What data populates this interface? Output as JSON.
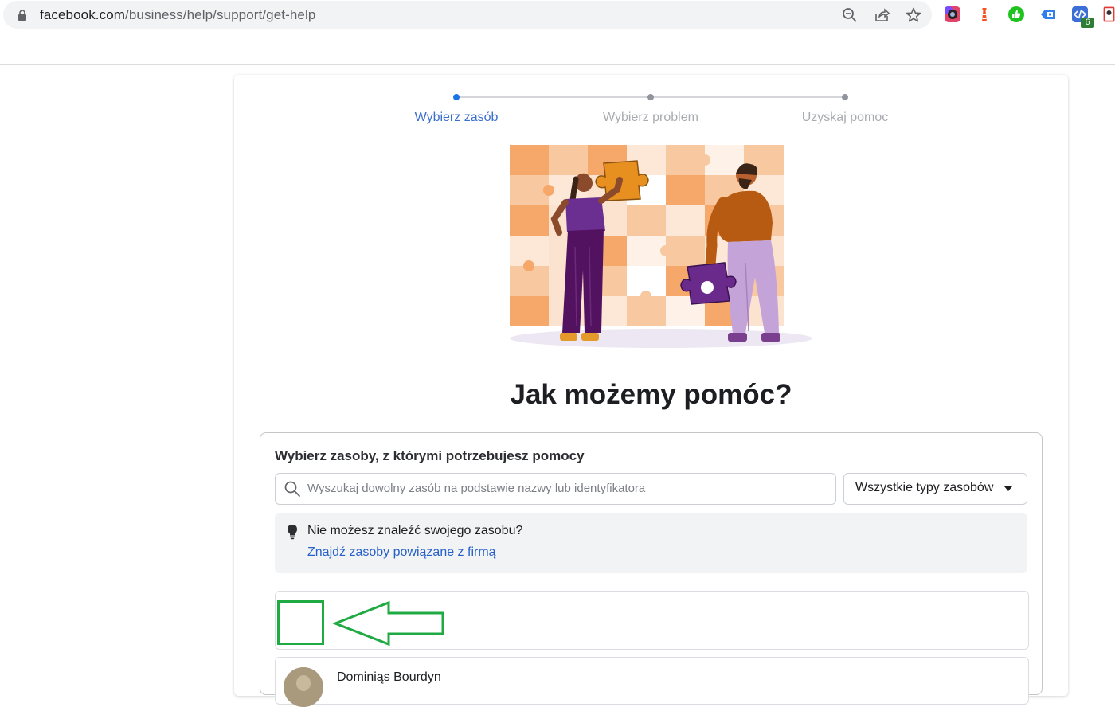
{
  "browser": {
    "url_host": "facebook.com",
    "url_path": "/business/help/support/get-help",
    "extension_badge": "6"
  },
  "stepper": {
    "steps": [
      {
        "label": "Wybierz zasób"
      },
      {
        "label": "Wybierz problem"
      },
      {
        "label": "Uzyskaj pomoc"
      }
    ]
  },
  "main": {
    "headline": "Jak możemy pomóc?",
    "panel_title": "Wybierz zasoby, z którymi potrzebujesz pomocy",
    "search_placeholder": "Wyszukaj dowolny zasób na podstawie nazwy lub identyfikatora",
    "type_filter": "Wszystkie typy zasobów",
    "tip_text": "Nie możesz znaleźć swojego zasobu?",
    "tip_link": "Znajdź zasoby powiązane z firmą",
    "rows": [
      {
        "name": ""
      },
      {
        "name": "Dominiąs Bourdyn"
      }
    ]
  },
  "colors": {
    "accent": "#1b74e4",
    "annotation": "#1faa43"
  }
}
